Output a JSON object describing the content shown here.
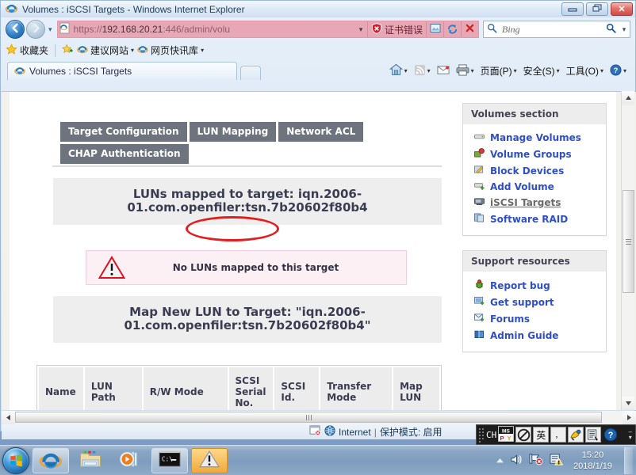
{
  "window": {
    "title": "Volumes : iSCSI Targets - Windows Internet Explorer",
    "ie_icon": "ie-logo-icon",
    "minimize_label": "–",
    "restore_label": "❐",
    "close_label": "✕"
  },
  "nav": {
    "back_label": "←",
    "forward_label": "→",
    "history_caret": "▾",
    "address": {
      "icon": "page-icon",
      "url_prefix": "https://",
      "url_host": "192.168.20.21",
      "url_suffix": ":446/admin/volu",
      "caret": "▾",
      "cert_error_label": "证书错误",
      "cert_error_icon": "shield-error-icon",
      "tool_compat_icon": "compatibility-view-icon",
      "tool_refresh_icon": "refresh-icon",
      "tool_stop_icon": "stop-icon"
    },
    "search": {
      "placeholder": "Bing",
      "icon": "magnifier-icon",
      "caret": "▾"
    }
  },
  "favorites": {
    "star_icon": "star-icon",
    "favorites_label": "收藏夹",
    "add_icon": "add-favorite-icon",
    "items": [
      {
        "label": "建议网站",
        "icon": "ie-page-icon"
      },
      {
        "label": "网页快讯库",
        "icon": "ie-page-icon"
      }
    ],
    "caret": "▾"
  },
  "browser_tabs": {
    "tabs": [
      {
        "label": "Volumes : iSCSI Targets",
        "icon": "ie-page-icon"
      }
    ],
    "new_tab_label": ""
  },
  "command_bar": {
    "items": [
      {
        "label": "",
        "icon": "home-icon",
        "caret": "▾"
      },
      {
        "label": "",
        "icon": "rss-feed-icon",
        "caret": "▾"
      },
      {
        "label": "",
        "icon": "mail-icon",
        "caret": ""
      },
      {
        "label": "",
        "icon": "print-icon",
        "caret": "▾"
      },
      {
        "label": "页面(P)",
        "icon": "",
        "caret": "▾"
      },
      {
        "label": "安全(S)",
        "icon": "",
        "caret": "▾"
      },
      {
        "label": "工具(O)",
        "icon": "",
        "caret": "▾"
      },
      {
        "label": "",
        "icon": "help-icon",
        "caret": "▾"
      }
    ]
  },
  "openfiler": {
    "tabs_row1": [
      {
        "label": "Target Configuration",
        "selected": false
      },
      {
        "label": "LUN Mapping",
        "selected": true
      },
      {
        "label": "Network ACL",
        "selected": false
      }
    ],
    "tabs_row2": [
      {
        "label": "CHAP Authentication",
        "selected": false
      }
    ],
    "mapped_banner": "LUNs mapped to target: iqn.2006-01.com.openfiler:tsn.7b20602f80b4",
    "mapped_banner_line1": "LUNs mapped to target: iqn.2006-",
    "mapped_banner_line2": "01.com.openfiler:tsn.7b20602f80b4",
    "alert": {
      "icon": "warning-triangle-icon",
      "text": "No LUNs mapped to this target"
    },
    "map_banner_line1": "Map New LUN to Target: \"iqn.2006-",
    "map_banner_line2": "01.com.openfiler:tsn.7b20602f80b4\"",
    "table": {
      "columns": [
        "Name",
        "LUN Path",
        "R/W Mode",
        "SCSI Serial No.",
        "SCSI Id.",
        "Transfer Mode",
        "Map LUN"
      ],
      "rows": []
    }
  },
  "sidebar": {
    "boxes": [
      {
        "title": "Volumes section",
        "links": [
          {
            "label": "Manage Volumes",
            "icon": "drive-icon",
            "active": false
          },
          {
            "label": "Volume Groups",
            "icon": "volume-group-icon",
            "active": false
          },
          {
            "label": "Block Devices",
            "icon": "block-device-icon",
            "active": false
          },
          {
            "label": "Add Volume",
            "icon": "add-volume-icon",
            "active": false
          },
          {
            "label": "iSCSI Targets",
            "icon": "server-icon",
            "active": true
          },
          {
            "label": "Software RAID",
            "icon": "raid-icon",
            "active": false
          }
        ]
      },
      {
        "title": "Support resources",
        "links": [
          {
            "label": "Report bug",
            "icon": "bug-icon",
            "active": false
          },
          {
            "label": "Get support",
            "icon": "support-icon",
            "active": false
          },
          {
            "label": "Forums",
            "icon": "forum-icon",
            "active": false
          },
          {
            "label": "Admin Guide",
            "icon": "book-icon",
            "active": false
          }
        ]
      }
    ]
  },
  "status_bar": {
    "error_icon": "page-error-icon",
    "zone_icon": "internet-zone-icon",
    "zone_label": "Internet",
    "separator": "|",
    "protected_mode_label": "保护模式: 启用"
  },
  "ime": {
    "lang_code": "CH",
    "logo_label": "MSPY",
    "keys": [
      {
        "label": "⃠",
        "name": "disabled-icon"
      },
      {
        "label": "英",
        "name": "english-mode-icon"
      },
      {
        "label": "，",
        "name": "punctuation-icon"
      },
      {
        "label": "✿",
        "name": "softkeyboard-icon"
      },
      {
        "label": "▤",
        "name": "ime-menu-icon"
      },
      {
        "label": "?",
        "name": "ime-help-icon"
      }
    ],
    "collapse_caret": "▾",
    "minimize_label": "–"
  },
  "taskbar": {
    "start_icon": "windows-start-orb",
    "buttons": [
      {
        "name": "taskbar-ie",
        "icon": "ie-logo-icon",
        "state": "active"
      },
      {
        "name": "taskbar-explorer",
        "icon": "folder-icon",
        "state": "normal"
      },
      {
        "name": "taskbar-media-player",
        "icon": "media-player-icon",
        "state": "normal"
      },
      {
        "name": "taskbar-command-prompt",
        "icon": "command-prompt-icon",
        "state": "active"
      },
      {
        "name": "taskbar-warning-app",
        "icon": "warning-triangle-icon",
        "state": "warn"
      }
    ],
    "tray": {
      "expand_caret": "▴",
      "volume_icon": "speaker-icon",
      "network_icon": "network-error-icon",
      "action_center_icon": "action-center-warning-icon"
    },
    "clock": {
      "time": "15:20",
      "date": "2018/1/19"
    }
  },
  "colors": {
    "tab_gray": "#6e747d",
    "link_blue": "#2f4fc8",
    "annotation_red": "#e02020",
    "alert_pink_bg": "#fdf0f5",
    "banner_gray": "#eeeeee"
  }
}
